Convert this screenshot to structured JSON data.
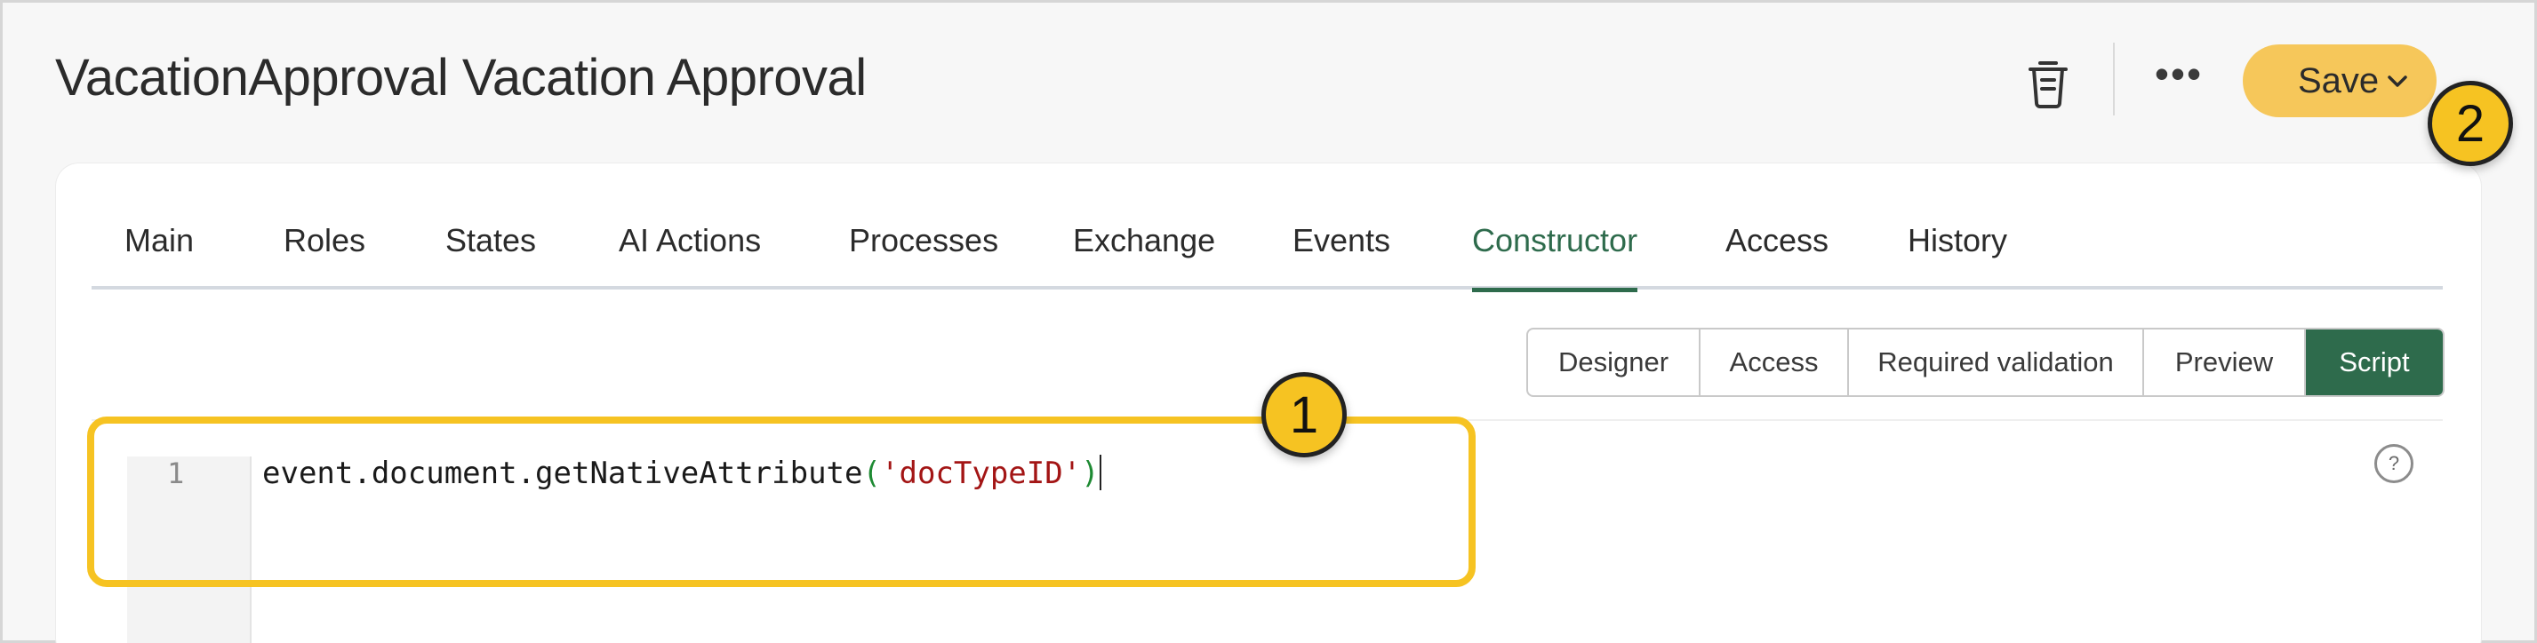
{
  "header": {
    "title": "VacationApproval Vacation Approval",
    "save_label": "Save",
    "more_label": "•••"
  },
  "tabs": [
    {
      "label": "Main"
    },
    {
      "label": "Roles"
    },
    {
      "label": "States"
    },
    {
      "label": "AI Actions"
    },
    {
      "label": "Processes"
    },
    {
      "label": "Exchange"
    },
    {
      "label": "Events"
    },
    {
      "label": "Constructor",
      "active": true
    },
    {
      "label": "Access"
    },
    {
      "label": "History"
    }
  ],
  "subtabs": [
    {
      "label": "Designer"
    },
    {
      "label": "Access"
    },
    {
      "label": "Required validation"
    },
    {
      "label": "Preview"
    },
    {
      "label": "Script",
      "active": true
    }
  ],
  "editor": {
    "line_number": "1",
    "code_prefix": "event.document.getNativeAttribute",
    "code_paren_open": "(",
    "code_string": "'docTypeID'",
    "code_paren_close": ")",
    "help_label": "?"
  },
  "annotations": {
    "badge_1": "1",
    "badge_2": "2"
  },
  "colors": {
    "accent": "#2e6b4c",
    "save_button": "#f6c75a",
    "highlight": "#f6c322"
  }
}
